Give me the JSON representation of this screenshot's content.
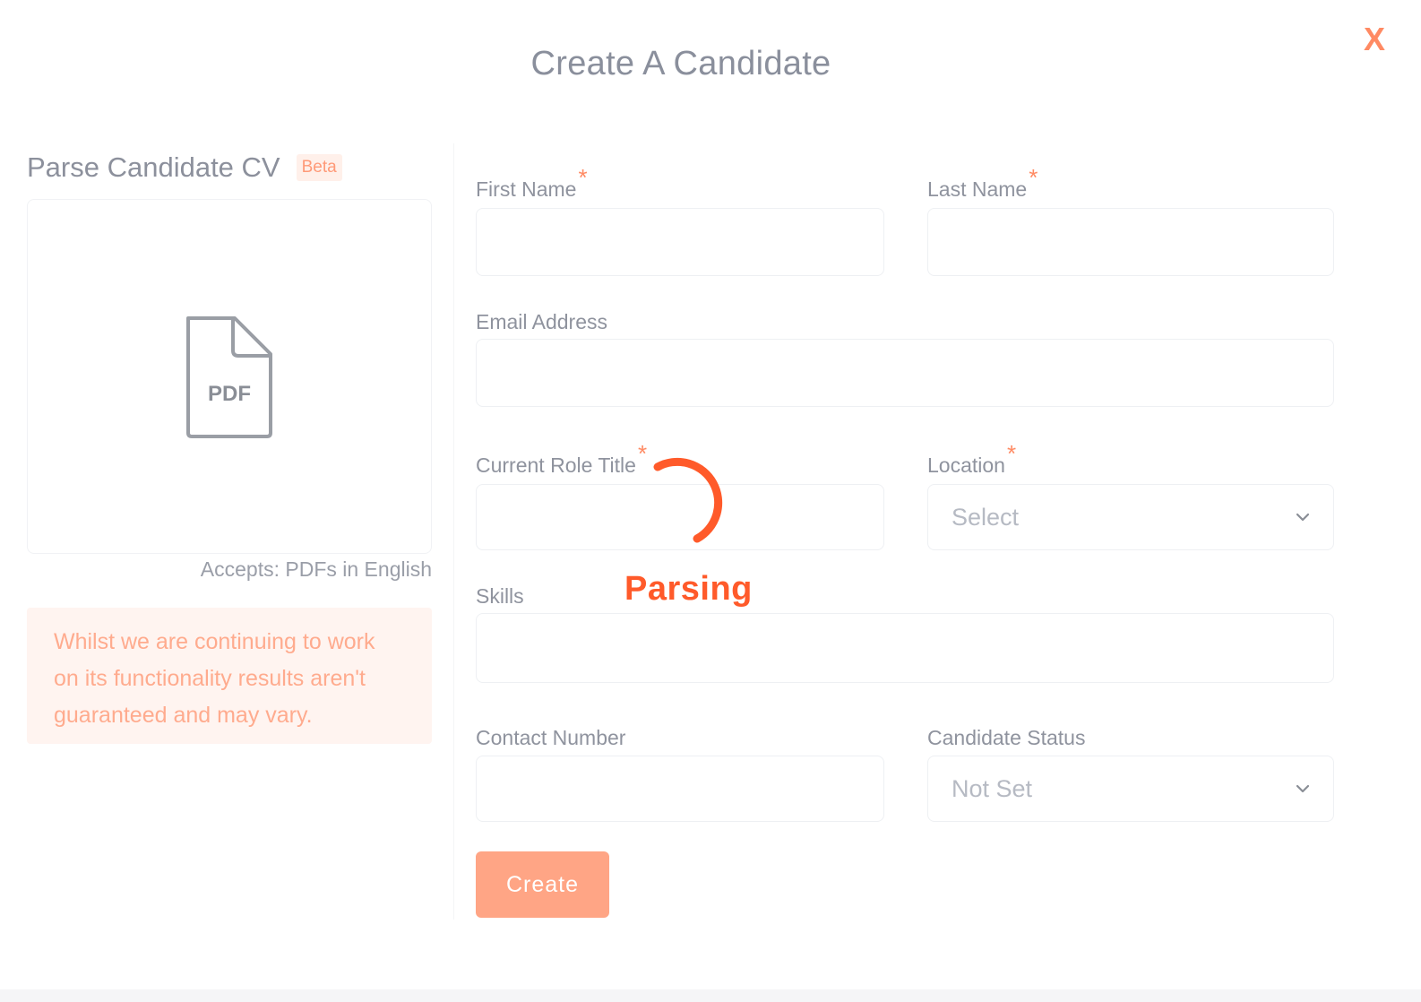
{
  "modal": {
    "title": "Create A Candidate",
    "close_label": "X"
  },
  "parse": {
    "title": "Parse Candidate CV",
    "badge": "Beta",
    "file_icon_label": "PDF",
    "accepts": "Accepts: PDFs in English",
    "notice": "Whilst we are continuing to work on its functionality results aren't guaranteed and may vary.",
    "status": "Parsing"
  },
  "form": {
    "first_name": {
      "label": "First Name",
      "required": "*",
      "value": ""
    },
    "last_name": {
      "label": "Last Name",
      "required": "*",
      "value": ""
    },
    "email": {
      "label": "Email Address",
      "value": ""
    },
    "current_role": {
      "label": "Current Role Title",
      "required": "*",
      "value": ""
    },
    "location": {
      "label": "Location",
      "required": "*",
      "selected": "Select"
    },
    "skills": {
      "label": "Skills",
      "value": ""
    },
    "contact_number": {
      "label": "Contact Number",
      "value": ""
    },
    "candidate_status": {
      "label": "Candidate Status",
      "selected": "Not Set"
    },
    "submit_label": "Create"
  },
  "colors": {
    "accent": "#ff8a63",
    "button": "#ffa585",
    "spinner": "#ff5a2a",
    "notice_bg": "#fff4f0"
  },
  "icons": {
    "close": "close-icon",
    "file": "pdf-file-icon",
    "dropdown": "chevron-down-icon",
    "loading": "spinner-icon"
  }
}
